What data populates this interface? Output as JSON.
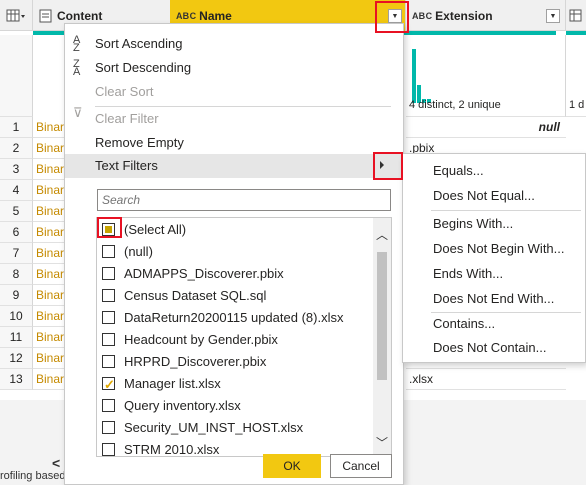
{
  "header": {
    "col_content": "Content",
    "col_name_type": "A B C",
    "col_name": "Name",
    "col_extension_type": "A B C",
    "col_extension": "Extension"
  },
  "profile": {
    "extension_summary": "4 distinct, 2 unique",
    "next_col_summary": "1 d"
  },
  "rows": {
    "numbers": [
      "1",
      "2",
      "3",
      "4",
      "5",
      "6",
      "7",
      "8",
      "9",
      "10",
      "11",
      "12",
      "13"
    ],
    "content_values": [
      "Binar",
      "Binar",
      "Binar",
      "Binar",
      "Binar",
      "Binar",
      "Binar",
      "Binar",
      "Binar",
      "Binar",
      "Binar",
      "Binar",
      "Binar"
    ],
    "extension_r1": "null",
    "extension_r2": ".pbix",
    "extension_r13": ".xlsx"
  },
  "menu": {
    "sort_asc": "Sort Ascending",
    "sort_desc": "Sort Descending",
    "clear_sort": "Clear Sort",
    "clear_filter": "Clear Filter",
    "remove_empty": "Remove Empty",
    "text_filters": "Text Filters",
    "search_placeholder": "Search",
    "ok": "OK",
    "cancel": "Cancel"
  },
  "filter_list": [
    {
      "label": "(Select All)",
      "state": "partial"
    },
    {
      "label": "(null)",
      "state": "unchecked"
    },
    {
      "label": "ADMAPPS_Discoverer.pbix",
      "state": "unchecked"
    },
    {
      "label": "Census Dataset SQL.sql",
      "state": "unchecked"
    },
    {
      "label": "DataReturn20200115 updated (8).xlsx",
      "state": "unchecked"
    },
    {
      "label": "Headcount by Gender.pbix",
      "state": "unchecked"
    },
    {
      "label": "HRPRD_Discoverer.pbix",
      "state": "unchecked"
    },
    {
      "label": "Manager list.xlsx",
      "state": "checked"
    },
    {
      "label": "Query inventory.xlsx",
      "state": "unchecked"
    },
    {
      "label": "Security_UM_INST_HOST.xlsx",
      "state": "unchecked"
    },
    {
      "label": "STRM 2010.xlsx",
      "state": "unchecked"
    }
  ],
  "submenu": {
    "equals": "Equals...",
    "not_equal": "Does Not Equal...",
    "begins_with": "Begins With...",
    "not_begin_with": "Does Not Begin With...",
    "ends_with": "Ends With...",
    "not_end_with": "Does Not End With...",
    "contains": "Contains...",
    "not_contain": "Does Not Contain..."
  },
  "status": {
    "text": "rofiling based"
  },
  "colors": {
    "accent": "#f2c811",
    "teal": "#01b8aa",
    "highlight_red": "#e81123"
  }
}
